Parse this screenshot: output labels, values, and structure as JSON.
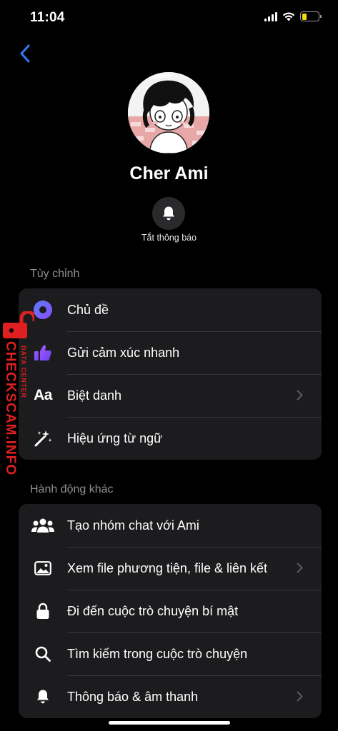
{
  "status_bar": {
    "time": "11:04",
    "battery_level": 0.3,
    "battery_color": "#f5d90a"
  },
  "nav": {
    "back_icon": "chevron-left-icon",
    "accent": "#3478f6"
  },
  "profile": {
    "name": "Cher Ami",
    "mute_icon": "bell-icon",
    "mute_label": "Tắt thông báo"
  },
  "customize": {
    "title": "Tùy chỉnh",
    "items": [
      {
        "label": "Chủ đề",
        "icon": "theme-circle-icon",
        "chevron": false
      },
      {
        "label": "Gửi cảm xúc nhanh",
        "icon": "thumbs-up-icon",
        "chevron": false
      },
      {
        "label": "Biệt danh",
        "icon": "text-aa-icon",
        "icon_text": "Aa",
        "chevron": true
      },
      {
        "label": "Hiệu ứng từ ngữ",
        "icon": "magic-wand-icon",
        "chevron": false
      }
    ]
  },
  "more_actions": {
    "title": "Hành động khác",
    "items": [
      {
        "label": "Tạo nhóm chat với Ami",
        "icon": "group-icon",
        "chevron": false
      },
      {
        "label": "Xem file phương tiện, file & liên kết",
        "icon": "image-icon",
        "chevron": true
      },
      {
        "label": "Đi đến cuộc trò chuyện bí mật",
        "icon": "lock-icon",
        "chevron": false
      },
      {
        "label": "Tìm kiếm trong cuộc trò chuyện",
        "icon": "search-icon",
        "chevron": false
      },
      {
        "label": "Thông báo & âm thanh",
        "icon": "bell-icon",
        "chevron": true
      }
    ]
  },
  "watermark": {
    "text": "CHECKSCAM.INFO",
    "subtext": "DATA CENTER"
  }
}
